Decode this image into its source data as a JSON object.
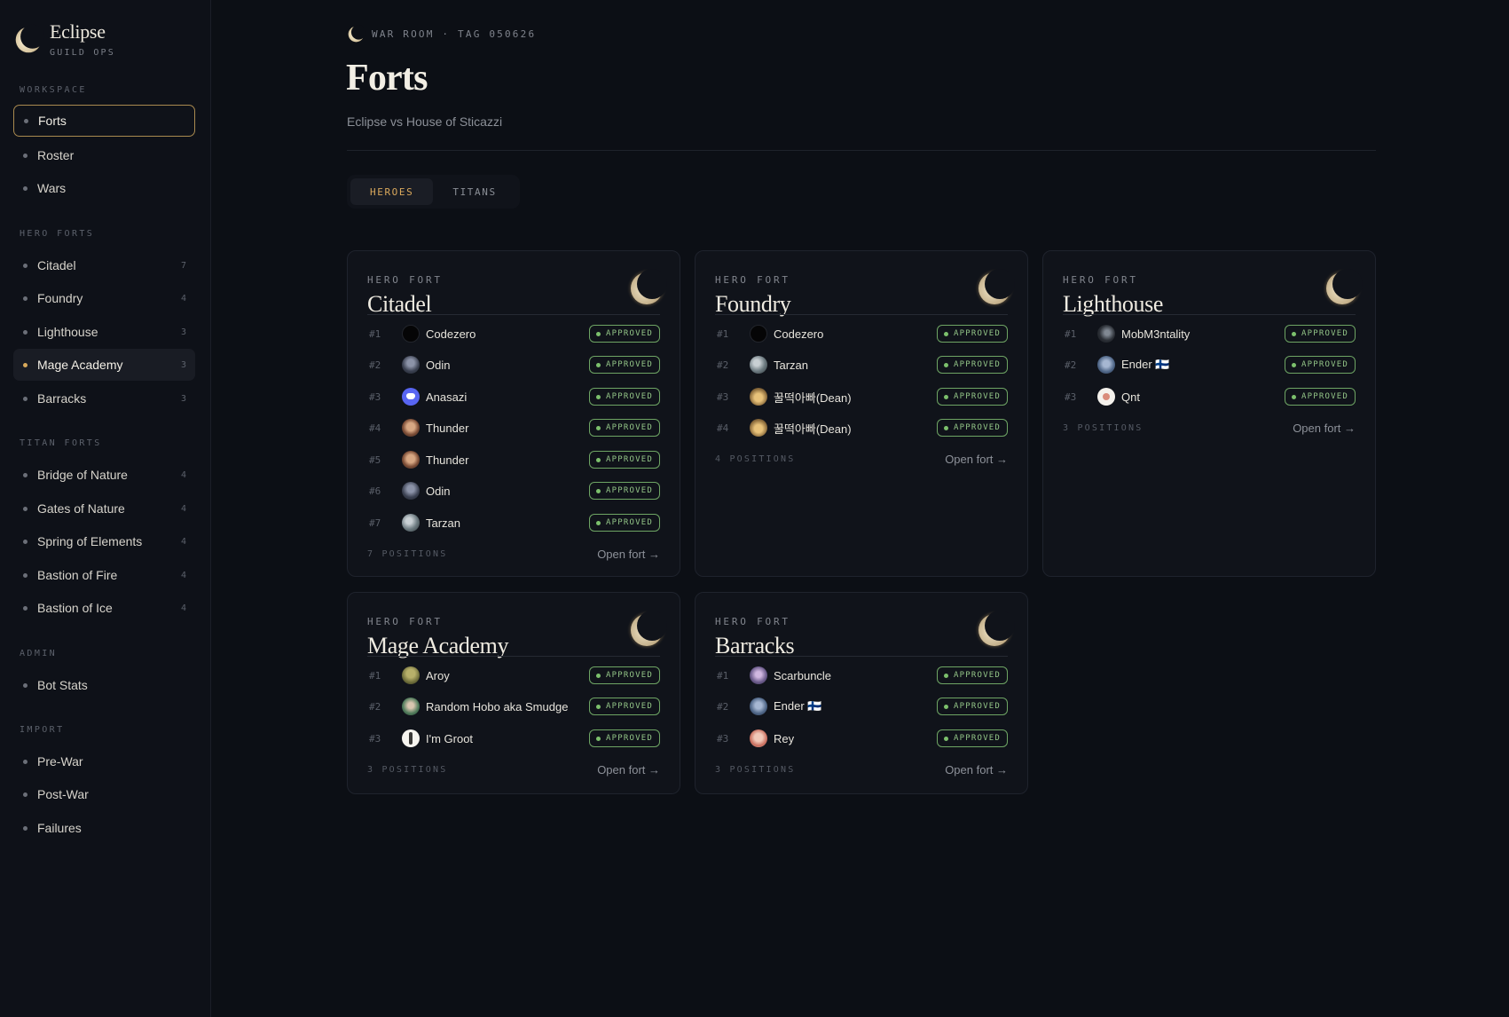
{
  "brand": {
    "title": "Eclipse",
    "subtitle": "GUILD OPS"
  },
  "nav": {
    "workspace": {
      "heading": "WORKSPACE",
      "items": [
        {
          "label": "Forts",
          "count": ""
        },
        {
          "label": "Roster",
          "count": ""
        },
        {
          "label": "Wars",
          "count": ""
        }
      ]
    },
    "hero_forts": {
      "heading": "HERO FORTS",
      "items": [
        {
          "label": "Citadel",
          "count": "7"
        },
        {
          "label": "Foundry",
          "count": "4"
        },
        {
          "label": "Lighthouse",
          "count": "3"
        },
        {
          "label": "Mage Academy",
          "count": "3"
        },
        {
          "label": "Barracks",
          "count": "3"
        }
      ]
    },
    "titan_forts": {
      "heading": "TITAN FORTS",
      "items": [
        {
          "label": "Bridge of Nature",
          "count": "4"
        },
        {
          "label": "Gates of Nature",
          "count": "4"
        },
        {
          "label": "Spring of Elements",
          "count": "4"
        },
        {
          "label": "Bastion of Fire",
          "count": "4"
        },
        {
          "label": "Bastion of Ice",
          "count": "4"
        }
      ]
    },
    "admin": {
      "heading": "ADMIN",
      "items": [
        {
          "label": "Bot Stats",
          "count": ""
        }
      ]
    },
    "import": {
      "heading": "IMPORT",
      "items": [
        {
          "label": "Pre-War",
          "count": ""
        },
        {
          "label": "Post-War",
          "count": ""
        },
        {
          "label": "Failures",
          "count": ""
        }
      ]
    }
  },
  "header": {
    "crumb": "WAR ROOM · TAG 050626",
    "title": "Forts",
    "subtitle": "Eclipse vs House of Sticazzi"
  },
  "tabs": [
    {
      "label": "HEROES"
    },
    {
      "label": "TITANS"
    }
  ],
  "cards": [
    {
      "kicker": "HERO FORT",
      "title": "Citadel",
      "count": "7 POSITIONS",
      "open": "Open fort →",
      "slots": [
        {
          "num": "#1",
          "name": "Codezero",
          "status": "APPROVED"
        },
        {
          "num": "#2",
          "name": "Odin",
          "status": "APPROVED"
        },
        {
          "num": "#3",
          "name": "Anasazi",
          "status": "APPROVED"
        },
        {
          "num": "#4",
          "name": "Thunder",
          "status": "APPROVED"
        },
        {
          "num": "#5",
          "name": "Thunder",
          "status": "APPROVED"
        },
        {
          "num": "#6",
          "name": "Odin",
          "status": "APPROVED"
        },
        {
          "num": "#7",
          "name": "Tarzan",
          "status": "APPROVED"
        }
      ]
    },
    {
      "kicker": "HERO FORT",
      "title": "Foundry",
      "count": "4 POSITIONS",
      "open": "Open fort →",
      "slots": [
        {
          "num": "#1",
          "name": "Codezero",
          "status": "APPROVED"
        },
        {
          "num": "#2",
          "name": "Tarzan",
          "status": "APPROVED"
        },
        {
          "num": "#3",
          "name": "꿀떡아빠(Dean)",
          "status": "APPROVED"
        },
        {
          "num": "#4",
          "name": "꿀떡아빠(Dean)",
          "status": "APPROVED"
        }
      ]
    },
    {
      "kicker": "HERO FORT",
      "title": "Lighthouse",
      "count": "3 POSITIONS",
      "open": "Open fort →",
      "slots": [
        {
          "num": "#1",
          "name": "MobM3ntality",
          "status": "APPROVED"
        },
        {
          "num": "#2",
          "name": "Ender 🇫🇮",
          "status": "APPROVED"
        },
        {
          "num": "#3",
          "name": "Qnt",
          "status": "APPROVED"
        }
      ]
    },
    {
      "kicker": "HERO FORT",
      "title": "Mage Academy",
      "count": "3 POSITIONS",
      "open": "Open fort →",
      "slots": [
        {
          "num": "#1",
          "name": "Aroy",
          "status": "APPROVED"
        },
        {
          "num": "#2",
          "name": "Random Hobo aka Smudge",
          "status": "APPROVED"
        },
        {
          "num": "#3",
          "name": "I'm Groot",
          "status": "APPROVED"
        }
      ]
    },
    {
      "kicker": "HERO FORT",
      "title": "Barracks",
      "count": "3 POSITIONS",
      "open": "Open fort →",
      "slots": [
        {
          "num": "#1",
          "name": "Scarbuncle",
          "status": "APPROVED"
        },
        {
          "num": "#2",
          "name": "Ender 🇫🇮",
          "status": "APPROVED"
        },
        {
          "num": "#3",
          "name": "Rey",
          "status": "APPROVED"
        }
      ]
    }
  ],
  "colors": {
    "accent": "#d9a85c",
    "approved": "#7cc06c",
    "background": "#0c0f15"
  }
}
